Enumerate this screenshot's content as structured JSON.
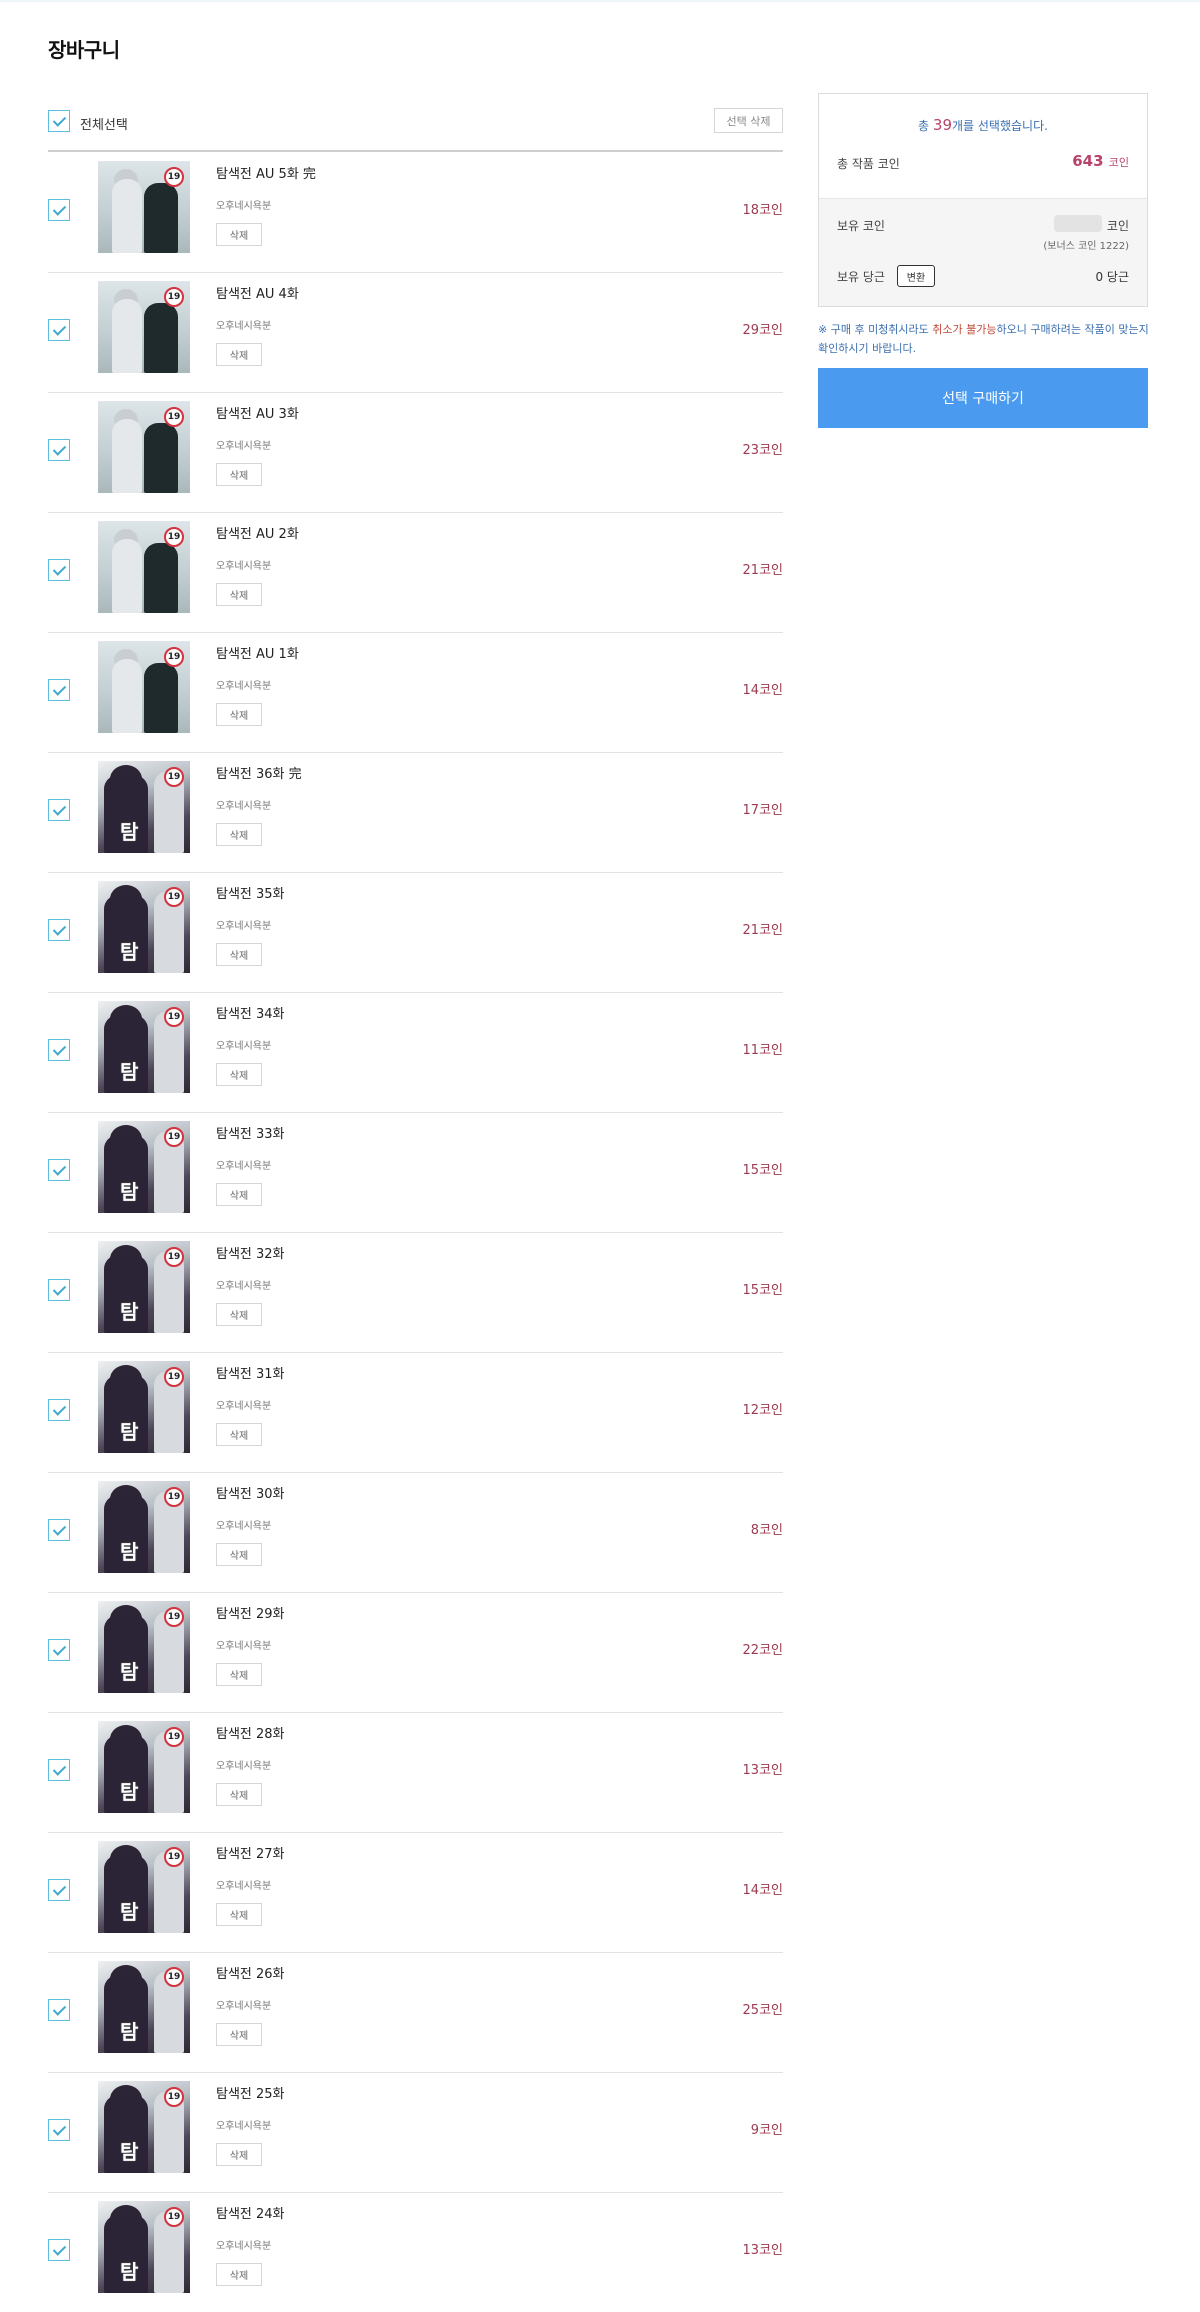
{
  "page": {
    "title": "장바구니"
  },
  "select_all": {
    "label": "전체선택",
    "delete_selected": "선택 삭제"
  },
  "cart": {
    "author": "오후네시욕분",
    "delete_label": "삭제",
    "items": [
      {
        "title": "탐색전 AU 5화 完",
        "price": "18코인",
        "cover": "au"
      },
      {
        "title": "탐색전 AU 4화",
        "price": "29코인",
        "cover": "au"
      },
      {
        "title": "탐색전 AU 3화",
        "price": "23코인",
        "cover": "au"
      },
      {
        "title": "탐색전 AU 2화",
        "price": "21코인",
        "cover": "au"
      },
      {
        "title": "탐색전 AU 1화",
        "price": "14코인",
        "cover": "au"
      },
      {
        "title": "탐색전 36화 完",
        "price": "17코인",
        "cover": "main"
      },
      {
        "title": "탐색전 35화",
        "price": "21코인",
        "cover": "main"
      },
      {
        "title": "탐색전 34화",
        "price": "11코인",
        "cover": "main"
      },
      {
        "title": "탐색전 33화",
        "price": "15코인",
        "cover": "main"
      },
      {
        "title": "탐색전 32화",
        "price": "15코인",
        "cover": "main"
      },
      {
        "title": "탐색전 31화",
        "price": "12코인",
        "cover": "main"
      },
      {
        "title": "탐색전 30화",
        "price": "8코인",
        "cover": "main"
      },
      {
        "title": "탐색전 29화",
        "price": "22코인",
        "cover": "main"
      },
      {
        "title": "탐색전 28화",
        "price": "13코인",
        "cover": "main"
      },
      {
        "title": "탐색전 27화",
        "price": "14코인",
        "cover": "main"
      },
      {
        "title": "탐색전 26화",
        "price": "25코인",
        "cover": "main"
      },
      {
        "title": "탐색전 25화",
        "price": "9코인",
        "cover": "main"
      },
      {
        "title": "탐색전 24화",
        "price": "13코인",
        "cover": "main"
      }
    ],
    "badge": "19",
    "cover_logo": "탐"
  },
  "summary": {
    "selected_prefix": "총 ",
    "selected_count": "39",
    "selected_suffix": "개를 선택했습니다.",
    "total_label": "총 작품 코인",
    "total_value": "643",
    "total_unit": "코인",
    "own_coin_label": "보유 코인",
    "own_coin_unit": "코인",
    "bonus_note": "(보너스 코인 1222)",
    "own_dang_label": "보유 당근",
    "convert_label": "변환",
    "own_dang_value": "0 당근"
  },
  "notice": {
    "mark": "※",
    "text_1": "구매 후 미청취시라도 ",
    "warn": "취소가 불가능",
    "text_2": "하오니 구매하려는 작품이 맞는지 확인하시기 바랍니다."
  },
  "buy_button": "선택 구매하기",
  "colors": {
    "accent_blue": "#4a9bef",
    "price": "#9c3b4f",
    "checkbox": "#5bc0de"
  }
}
